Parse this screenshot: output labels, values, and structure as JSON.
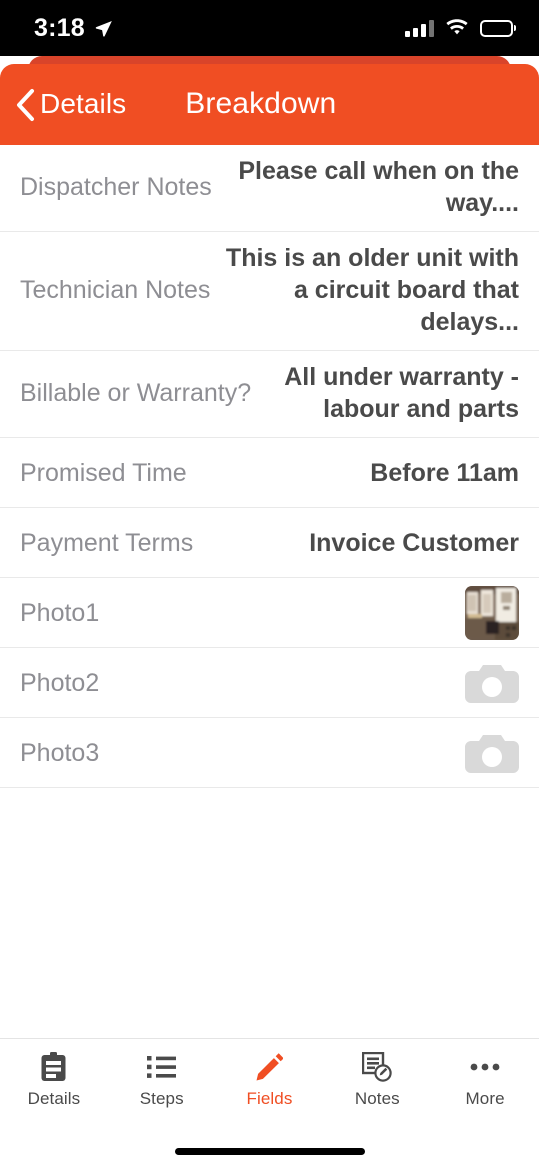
{
  "status_bar": {
    "time": "3:18",
    "location_icon": "location-arrow-icon",
    "signal_icon": "cellular-signal-icon",
    "wifi_icon": "wifi-icon",
    "battery_icon": "battery-low-power-icon",
    "battery_level_percent": 45,
    "battery_color": "#ffd60a"
  },
  "header": {
    "back_label": "Details",
    "back_icon": "chevron-left-icon",
    "title": "Breakdown",
    "background_color": "#f04e23",
    "back_card_color": "#d9442a"
  },
  "fields": [
    {
      "label": "Dispatcher Notes",
      "value": "Please call when on the way....",
      "type": "text"
    },
    {
      "label": "Technician Notes",
      "value": "This is an older unit with a circuit board that delays...",
      "type": "text"
    },
    {
      "label": "Billable or Warranty?",
      "value": "All under warranty - labour and parts",
      "type": "text"
    },
    {
      "label": "Promised Time",
      "value": "Before 11am",
      "type": "text"
    },
    {
      "label": "Payment Terms",
      "value": "Invoice Customer",
      "type": "text"
    },
    {
      "label": "Photo1",
      "value": "",
      "type": "photo",
      "has_image": true,
      "icon": "photo-thumbnail"
    },
    {
      "label": "Photo2",
      "value": "",
      "type": "photo",
      "has_image": false,
      "icon": "camera-icon"
    },
    {
      "label": "Photo3",
      "value": "",
      "type": "photo",
      "has_image": false,
      "icon": "camera-icon"
    }
  ],
  "tabs": [
    {
      "label": "Details",
      "icon": "clipboard-icon",
      "active": false
    },
    {
      "label": "Steps",
      "icon": "list-bullet-icon",
      "active": false
    },
    {
      "label": "Fields",
      "icon": "pencil-icon",
      "active": true
    },
    {
      "label": "Notes",
      "icon": "note-edit-icon",
      "active": false
    },
    {
      "label": "More",
      "icon": "ellipsis-icon",
      "active": false
    }
  ],
  "accent_color": "#f04e23",
  "label_color": "#8e8e93",
  "value_color": "#4a4a4a"
}
